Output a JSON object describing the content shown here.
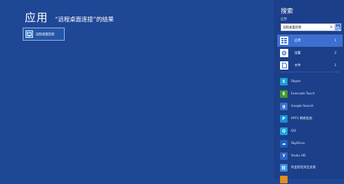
{
  "results": {
    "heading": "应用",
    "subheading": "“远程桌面连接”的结果",
    "tile_label": "远程桌面连接",
    "tile_icon": "remote-desktop-icon"
  },
  "search_pane": {
    "title": "搜索",
    "scope_label": "应用",
    "query": "远程桌面连接",
    "clear_glyph": "×",
    "scopes": [
      {
        "label": "应用",
        "count": "1",
        "icon": "apps-icon",
        "selected": true
      },
      {
        "label": "设置",
        "count": "2",
        "icon": "settings-icon",
        "selected": false
      },
      {
        "label": "文件",
        "count": "1",
        "icon": "files-icon",
        "selected": false
      }
    ],
    "apps": [
      {
        "label": "Skype",
        "icon": "skype-icon",
        "color": "#1d9ad6"
      },
      {
        "label": "Evernote Touch",
        "icon": "evernote-icon",
        "color": "#3f9a2f"
      },
      {
        "label": "Google Search",
        "icon": "google-search-icon",
        "color": "#3b6fc9"
      },
      {
        "label": "PPTV 网络电视",
        "icon": "pptv-icon",
        "color": "#1a8fd6"
      },
      {
        "label": "QQ",
        "icon": "qq-icon",
        "color": "#1aa6d8"
      },
      {
        "label": "SkyDrive",
        "icon": "skydrive-icon",
        "color": "#1e5fbf"
      },
      {
        "label": "Youku HD",
        "icon": "youku-icon",
        "color": "#2c66c4"
      },
      {
        "label": "阿里旺旺淘宝卖家",
        "icon": "aliwangwang-icon",
        "color": "#3a8ee0"
      },
      {
        "label": "",
        "icon": "app-icon",
        "color": "#e08f1e"
      }
    ]
  },
  "colors": {
    "background": "#1e4796",
    "pane_background": "#1c3f89",
    "selected_scope": "#3d6fcf",
    "search_button": "#3a78d8"
  }
}
